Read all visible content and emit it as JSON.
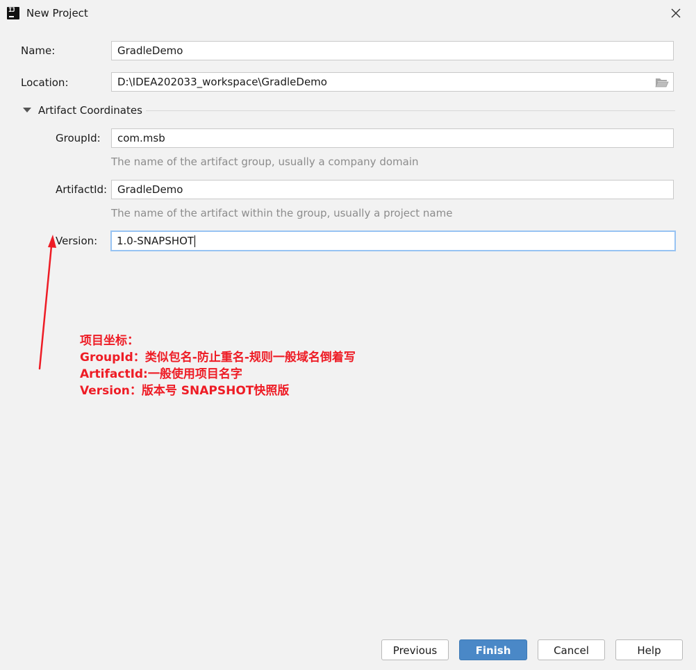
{
  "window": {
    "title": "New Project",
    "icon": "intellij-idea-icon",
    "icon_glyph": "IJ",
    "close_icon": "close-icon"
  },
  "form": {
    "name": {
      "label": "Name:",
      "value": "GradleDemo"
    },
    "location": {
      "label": "Location:",
      "value": "D:\\IDEA202033_workspace\\GradleDemo",
      "browse_icon": "folder-icon"
    },
    "artifact_section": {
      "title": "Artifact Coordinates",
      "expanded": true
    },
    "group_id": {
      "label": "GroupId:",
      "value": "com.msb",
      "hint": "The name of the artifact group, usually a company domain"
    },
    "artifact_id": {
      "label": "ArtifactId:",
      "value": "GradleDemo",
      "hint": "The name of the artifact within the group, usually a project name"
    },
    "version": {
      "label": "Version:",
      "value": "1.0-SNAPSHOT",
      "focused": true
    }
  },
  "annotation": {
    "color": "#ee1c25",
    "lines": [
      "项目坐标：",
      "GroupId：类似包名-防止重名-规则一般域名倒着写",
      "ArtifactId:一般使用项目名字",
      "Version：版本号  SNAPSHOT快照版"
    ]
  },
  "buttons": {
    "previous": "Previous",
    "finish": "Finish",
    "cancel": "Cancel",
    "help": "Help"
  },
  "colors": {
    "background": "#f2f2f2",
    "primary_button": "#4a88c7",
    "focus_border": "#97c3f3",
    "hint_text": "#8c8c8c"
  }
}
